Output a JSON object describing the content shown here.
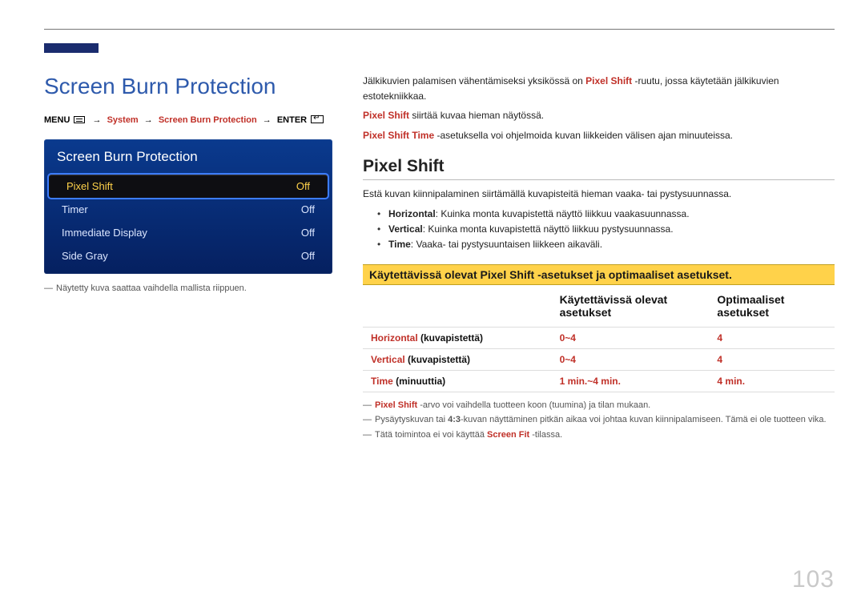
{
  "page": {
    "title": "Screen Burn Protection",
    "number": "103"
  },
  "breadcrumb": {
    "menu": "MENU",
    "system": "System",
    "sbp": "Screen Burn Protection",
    "enter": "ENTER"
  },
  "panel": {
    "title": "Screen Burn Protection",
    "rows": [
      {
        "label": "Pixel Shift",
        "value": "Off",
        "selected": true
      },
      {
        "label": "Timer",
        "value": "Off",
        "selected": false
      },
      {
        "label": "Immediate Display",
        "value": "Off",
        "selected": false
      },
      {
        "label": "Side Gray",
        "value": "Off",
        "selected": false
      }
    ]
  },
  "left_note": "Näytetty kuva saattaa vaihdella mallista riippuen.",
  "intro": {
    "p1_pre": "Jälkikuvien palamisen vähentämiseksi yksikössä on ",
    "p1_red": "Pixel Shift",
    "p1_post": " -ruutu, jossa käytetään jälkikuvien estotekniikkaa.",
    "p2_red": "Pixel Shift",
    "p2_rest": " siirtää kuvaa hieman näytössä.",
    "p3_red": "Pixel Shift Time",
    "p3_rest": " -asetuksella voi ohjelmoida kuvan liikkeiden välisen ajan minuuteissa."
  },
  "section": {
    "title": "Pixel Shift",
    "desc": "Estä kuvan kiinnipalaminen siirtämällä kuvapisteitä hieman vaaka- tai pystysuunnassa.",
    "bullets": [
      {
        "label": "Horizontal",
        "text": ": Kuinka monta kuvapistettä näyttö liikkuu vaakasuunnassa."
      },
      {
        "label": "Vertical",
        "text": ": Kuinka monta kuvapistettä näyttö liikkuu pystysuunnassa."
      },
      {
        "label": "Time",
        "text": ": Vaaka- tai pystysuuntaisen liikkeen aikaväli."
      }
    ]
  },
  "table": {
    "highlight": "Käytettävissä olevat Pixel Shift -asetukset ja optimaaliset asetukset.",
    "head_avail": "Käytettävissä olevat asetukset",
    "head_opt": "Optimaaliset asetukset",
    "rows": [
      {
        "red": "Horizontal",
        "paren": " (kuvapistettä)",
        "avail": "0~4",
        "opt": "4"
      },
      {
        "red": "Vertical",
        "paren": " (kuvapistettä)",
        "avail": "0~4",
        "opt": "4"
      },
      {
        "red": "Time",
        "paren": " (minuuttia)",
        "avail": "1 min.~4 min.",
        "opt": "4 min."
      }
    ]
  },
  "notes": {
    "n1_red": "Pixel Shift",
    "n1_rest": " -arvo voi vaihdella tuotteen koon (tuumina) ja tilan mukaan.",
    "n2_pre": "Pysäytyskuvan tai ",
    "n2_b": "4:3",
    "n2_post": "-kuvan näyttäminen pitkän aikaa voi johtaa kuvan kiinnipalamiseen. Tämä ei ole tuotteen vika.",
    "n3_pre": "Tätä toimintoa ei voi käyttää ",
    "n3_red": "Screen Fit",
    "n3_post": " -tilassa."
  }
}
